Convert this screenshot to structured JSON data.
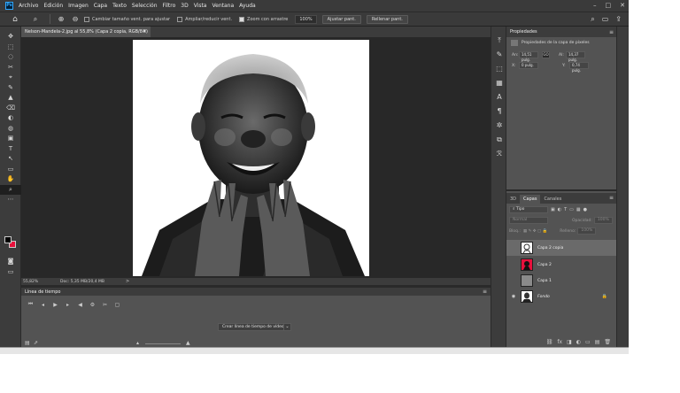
{
  "app": {
    "logo_text": "Ps",
    "menus": [
      "Archivo",
      "Edición",
      "Imagen",
      "Capa",
      "Texto",
      "Selección",
      "Filtro",
      "3D",
      "Vista",
      "Ventana",
      "Ayuda"
    ],
    "window_controls": [
      "–",
      "□",
      "✕"
    ]
  },
  "options_bar": {
    "resize_windows_label": "Cambiar tamaño vent. para ajustar",
    "zoom_all_label": "Ampliar/reducir vent.",
    "scrubby_zoom_label": "Zoom con arrastre",
    "zoom_value": "100%",
    "fit_screen_label": "Ajustar pant.",
    "fill_screen_label": "Rellenar pant."
  },
  "tools": [
    "✥",
    "⬚",
    "◌",
    "✂",
    "⌖",
    "✎",
    "▲",
    "⌫",
    "◐",
    "◍",
    "▣",
    "T",
    "↖",
    "▭",
    "✋",
    "⌕",
    "⋯"
  ],
  "document": {
    "tab_title": "Nelson-Mandela-2.jpg al 55,8% (Capa 2 copia, RGB/8#) *",
    "tab_close": "×",
    "colors": {
      "foreground": "#000000",
      "background": "#e8103c"
    }
  },
  "status": {
    "zoom": "55,82%",
    "doc_info": "Doc: 5,35 MB/20,4 MB",
    "arrow": ">"
  },
  "timeline": {
    "title": "Línea de tiempo",
    "menu_icon": "≡",
    "controls": [
      "⏮",
      "◂",
      "▶",
      "▸",
      "◀",
      "⚙",
      "✂",
      "▢"
    ],
    "create_button": "Crear línea de tiempo de vídeo",
    "create_arrow": "⌄"
  },
  "panel_icons": [
    "⤒",
    "✎",
    "⬚",
    "▦",
    "A",
    "¶",
    "✲",
    "⧉",
    "ℛ"
  ],
  "properties": {
    "title": "Propiedades",
    "subtitle": "Propiedades de la capa de píxeles",
    "w_label": "An:",
    "w_value": "14,51 pulg.",
    "link": "GO",
    "h_label": "Al:",
    "h_value": "14,37 pulg.",
    "x_label": "X:",
    "x_value": "0 pulg.",
    "y_label": "Y:",
    "y_value": "0,74 pulg."
  },
  "layers_panel": {
    "tabs": [
      "3D",
      "Capas",
      "Canales"
    ],
    "active_tab": "Capas",
    "filter_kind": "Tipo",
    "blend_mode": "Normal",
    "opacity_label": "Opacidad:",
    "opacity_value": "100%",
    "lock_label": "Bloq.:",
    "fill_label": "Relleno:",
    "fill_value": "100%",
    "layers": [
      {
        "name": "Capa 2 copia",
        "visible": false,
        "selected": true,
        "locked": false
      },
      {
        "name": "Capa 2",
        "visible": false,
        "selected": false,
        "locked": false
      },
      {
        "name": "Capa 1",
        "visible": false,
        "selected": false,
        "locked": false
      },
      {
        "name": "Fondo",
        "visible": true,
        "selected": false,
        "locked": true
      }
    ],
    "footer_icons": [
      "⛓",
      "fx",
      "◨",
      "◐",
      "▭",
      "▤",
      "🗑"
    ]
  }
}
